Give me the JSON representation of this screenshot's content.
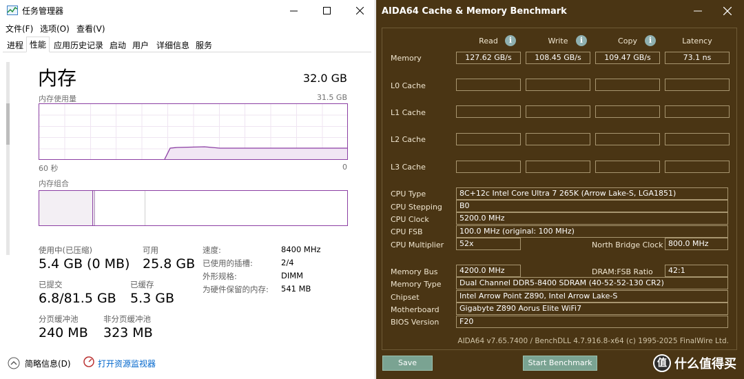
{
  "task_manager": {
    "title": "任务管理器",
    "menu": [
      "文件(F)",
      "选项(O)",
      "查看(V)"
    ],
    "tabs": [
      "进程",
      "性能",
      "应用历史记录",
      "启动",
      "用户",
      "详细信息",
      "服务"
    ],
    "active_tab": "性能",
    "heading": "内存",
    "total": "32.0 GB",
    "usage_label": "内存使用量",
    "usage_max": "31.5 GB",
    "time_start": "60 秒",
    "time_end": "0",
    "composition_label": "内存组合",
    "stats": {
      "in_use_label": "使用中(已压缩)",
      "in_use_value": "5.4 GB (0 MB)",
      "available_label": "可用",
      "available_value": "25.8 GB",
      "committed_label": "已提交",
      "committed_value": "6.8/81.5 GB",
      "cached_label": "已缓存",
      "cached_value": "5.3 GB",
      "paged_label": "分页缓冲池",
      "paged_value": "240 MB",
      "nonpaged_label": "非分页缓冲池",
      "nonpaged_value": "323 MB"
    },
    "details": [
      {
        "label": "速度:",
        "value": "8400 MHz"
      },
      {
        "label": "已使用的插槽:",
        "value": "2/4"
      },
      {
        "label": "外形规格:",
        "value": "DIMM"
      },
      {
        "label": "为硬件保留的内存:",
        "value": "541 MB"
      }
    ],
    "footer": {
      "summary_label": "简略信息(D)",
      "monitor_label": "打开资源监视器"
    },
    "colors": {
      "accent": "#8b3ea3",
      "link": "#0066cc"
    }
  },
  "aida": {
    "title": "AIDA64 Cache & Memory Benchmark",
    "columns": [
      "Read",
      "Write",
      "Copy",
      "Latency"
    ],
    "rows": [
      {
        "label": "Memory",
        "values": [
          "127.62 GB/s",
          "108.45 GB/s",
          "109.47 GB/s",
          "73.1 ns"
        ]
      },
      {
        "label": "L0 Cache",
        "values": [
          "",
          "",
          "",
          ""
        ]
      },
      {
        "label": "L1 Cache",
        "values": [
          "",
          "",
          "",
          ""
        ]
      },
      {
        "label": "L2 Cache",
        "values": [
          "",
          "",
          "",
          ""
        ]
      },
      {
        "label": "L3 Cache",
        "values": [
          "",
          "",
          "",
          ""
        ]
      }
    ],
    "cpu_type_label": "CPU Type",
    "cpu_type": "8C+12c Intel Core Ultra 7 265K  (Arrow Lake-S, LGA1851)",
    "cpu_stepping_label": "CPU Stepping",
    "cpu_stepping": "B0",
    "cpu_clock_label": "CPU Clock",
    "cpu_clock": "5200.0 MHz",
    "cpu_fsb_label": "CPU FSB",
    "cpu_fsb": "100.0 MHz  (original: 100 MHz)",
    "cpu_multiplier_label": "CPU Multiplier",
    "cpu_multiplier": "52x",
    "nb_clock_label": "North Bridge Clock",
    "nb_clock": "800.0 MHz",
    "memory_bus_label": "Memory Bus",
    "memory_bus": "4200.0 MHz",
    "dram_fsb_label": "DRAM:FSB Ratio",
    "dram_fsb": "42:1",
    "memory_type_label": "Memory Type",
    "memory_type": "Dual Channel DDR5-8400 SDRAM  (40-52-52-130 CR2)",
    "chipset_label": "Chipset",
    "chipset": "Intel Arrow Point Z890, Intel Arrow Lake-S",
    "motherboard_label": "Motherboard",
    "motherboard": "Gigabyte Z890 Aorus Elite WiFi7",
    "bios_label": "BIOS Version",
    "bios": "F20",
    "footer": "AIDA64 v7.65.7400 / BenchDLL 4.7.916.8-x64  (c) 1995-2025 FinalWire Ltd.",
    "save_label": "Save",
    "start_label": "Start Benchmark",
    "watermark": "什么值得买",
    "watermark_logo": "值",
    "colors": {
      "background": "#4a3514",
      "button": "#7aa392",
      "info": "#8fb0b0"
    }
  }
}
